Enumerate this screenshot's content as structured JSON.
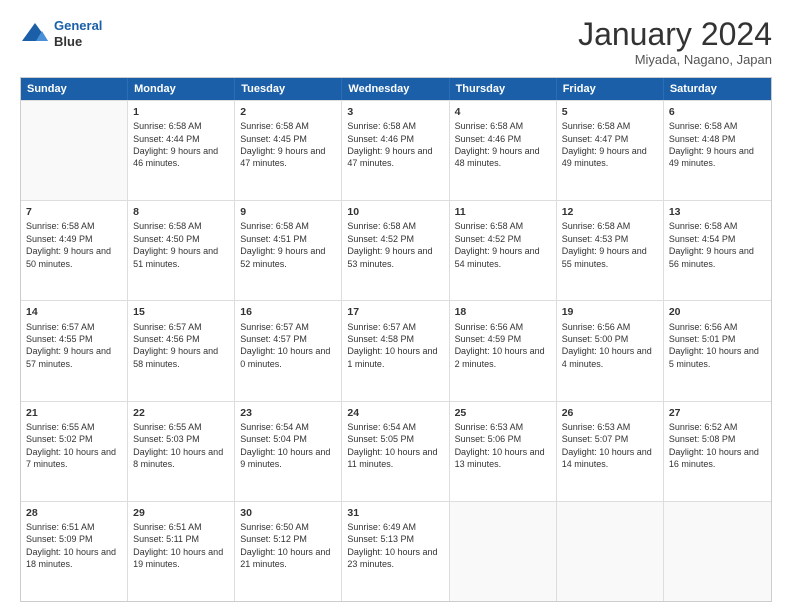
{
  "header": {
    "logo_line1": "General",
    "logo_line2": "Blue",
    "month_title": "January 2024",
    "location": "Miyada, Nagano, Japan"
  },
  "days_of_week": [
    "Sunday",
    "Monday",
    "Tuesday",
    "Wednesday",
    "Thursday",
    "Friday",
    "Saturday"
  ],
  "weeks": [
    [
      {
        "day": "",
        "empty": true
      },
      {
        "day": "1",
        "sunrise": "6:58 AM",
        "sunset": "4:44 PM",
        "daylight": "9 hours and 46 minutes."
      },
      {
        "day": "2",
        "sunrise": "6:58 AM",
        "sunset": "4:45 PM",
        "daylight": "9 hours and 47 minutes."
      },
      {
        "day": "3",
        "sunrise": "6:58 AM",
        "sunset": "4:46 PM",
        "daylight": "9 hours and 47 minutes."
      },
      {
        "day": "4",
        "sunrise": "6:58 AM",
        "sunset": "4:46 PM",
        "daylight": "9 hours and 48 minutes."
      },
      {
        "day": "5",
        "sunrise": "6:58 AM",
        "sunset": "4:47 PM",
        "daylight": "9 hours and 49 minutes."
      },
      {
        "day": "6",
        "sunrise": "6:58 AM",
        "sunset": "4:48 PM",
        "daylight": "9 hours and 49 minutes."
      }
    ],
    [
      {
        "day": "7",
        "sunrise": "6:58 AM",
        "sunset": "4:49 PM",
        "daylight": "9 hours and 50 minutes."
      },
      {
        "day": "8",
        "sunrise": "6:58 AM",
        "sunset": "4:50 PM",
        "daylight": "9 hours and 51 minutes."
      },
      {
        "day": "9",
        "sunrise": "6:58 AM",
        "sunset": "4:51 PM",
        "daylight": "9 hours and 52 minutes."
      },
      {
        "day": "10",
        "sunrise": "6:58 AM",
        "sunset": "4:52 PM",
        "daylight": "9 hours and 53 minutes."
      },
      {
        "day": "11",
        "sunrise": "6:58 AM",
        "sunset": "4:52 PM",
        "daylight": "9 hours and 54 minutes."
      },
      {
        "day": "12",
        "sunrise": "6:58 AM",
        "sunset": "4:53 PM",
        "daylight": "9 hours and 55 minutes."
      },
      {
        "day": "13",
        "sunrise": "6:58 AM",
        "sunset": "4:54 PM",
        "daylight": "9 hours and 56 minutes."
      }
    ],
    [
      {
        "day": "14",
        "sunrise": "6:57 AM",
        "sunset": "4:55 PM",
        "daylight": "9 hours and 57 minutes."
      },
      {
        "day": "15",
        "sunrise": "6:57 AM",
        "sunset": "4:56 PM",
        "daylight": "9 hours and 58 minutes."
      },
      {
        "day": "16",
        "sunrise": "6:57 AM",
        "sunset": "4:57 PM",
        "daylight": "10 hours and 0 minutes."
      },
      {
        "day": "17",
        "sunrise": "6:57 AM",
        "sunset": "4:58 PM",
        "daylight": "10 hours and 1 minute."
      },
      {
        "day": "18",
        "sunrise": "6:56 AM",
        "sunset": "4:59 PM",
        "daylight": "10 hours and 2 minutes."
      },
      {
        "day": "19",
        "sunrise": "6:56 AM",
        "sunset": "5:00 PM",
        "daylight": "10 hours and 4 minutes."
      },
      {
        "day": "20",
        "sunrise": "6:56 AM",
        "sunset": "5:01 PM",
        "daylight": "10 hours and 5 minutes."
      }
    ],
    [
      {
        "day": "21",
        "sunrise": "6:55 AM",
        "sunset": "5:02 PM",
        "daylight": "10 hours and 7 minutes."
      },
      {
        "day": "22",
        "sunrise": "6:55 AM",
        "sunset": "5:03 PM",
        "daylight": "10 hours and 8 minutes."
      },
      {
        "day": "23",
        "sunrise": "6:54 AM",
        "sunset": "5:04 PM",
        "daylight": "10 hours and 9 minutes."
      },
      {
        "day": "24",
        "sunrise": "6:54 AM",
        "sunset": "5:05 PM",
        "daylight": "10 hours and 11 minutes."
      },
      {
        "day": "25",
        "sunrise": "6:53 AM",
        "sunset": "5:06 PM",
        "daylight": "10 hours and 13 minutes."
      },
      {
        "day": "26",
        "sunrise": "6:53 AM",
        "sunset": "5:07 PM",
        "daylight": "10 hours and 14 minutes."
      },
      {
        "day": "27",
        "sunrise": "6:52 AM",
        "sunset": "5:08 PM",
        "daylight": "10 hours and 16 minutes."
      }
    ],
    [
      {
        "day": "28",
        "sunrise": "6:51 AM",
        "sunset": "5:09 PM",
        "daylight": "10 hours and 18 minutes."
      },
      {
        "day": "29",
        "sunrise": "6:51 AM",
        "sunset": "5:11 PM",
        "daylight": "10 hours and 19 minutes."
      },
      {
        "day": "30",
        "sunrise": "6:50 AM",
        "sunset": "5:12 PM",
        "daylight": "10 hours and 21 minutes."
      },
      {
        "day": "31",
        "sunrise": "6:49 AM",
        "sunset": "5:13 PM",
        "daylight": "10 hours and 23 minutes."
      },
      {
        "day": "",
        "empty": true
      },
      {
        "day": "",
        "empty": true
      },
      {
        "day": "",
        "empty": true
      }
    ]
  ]
}
